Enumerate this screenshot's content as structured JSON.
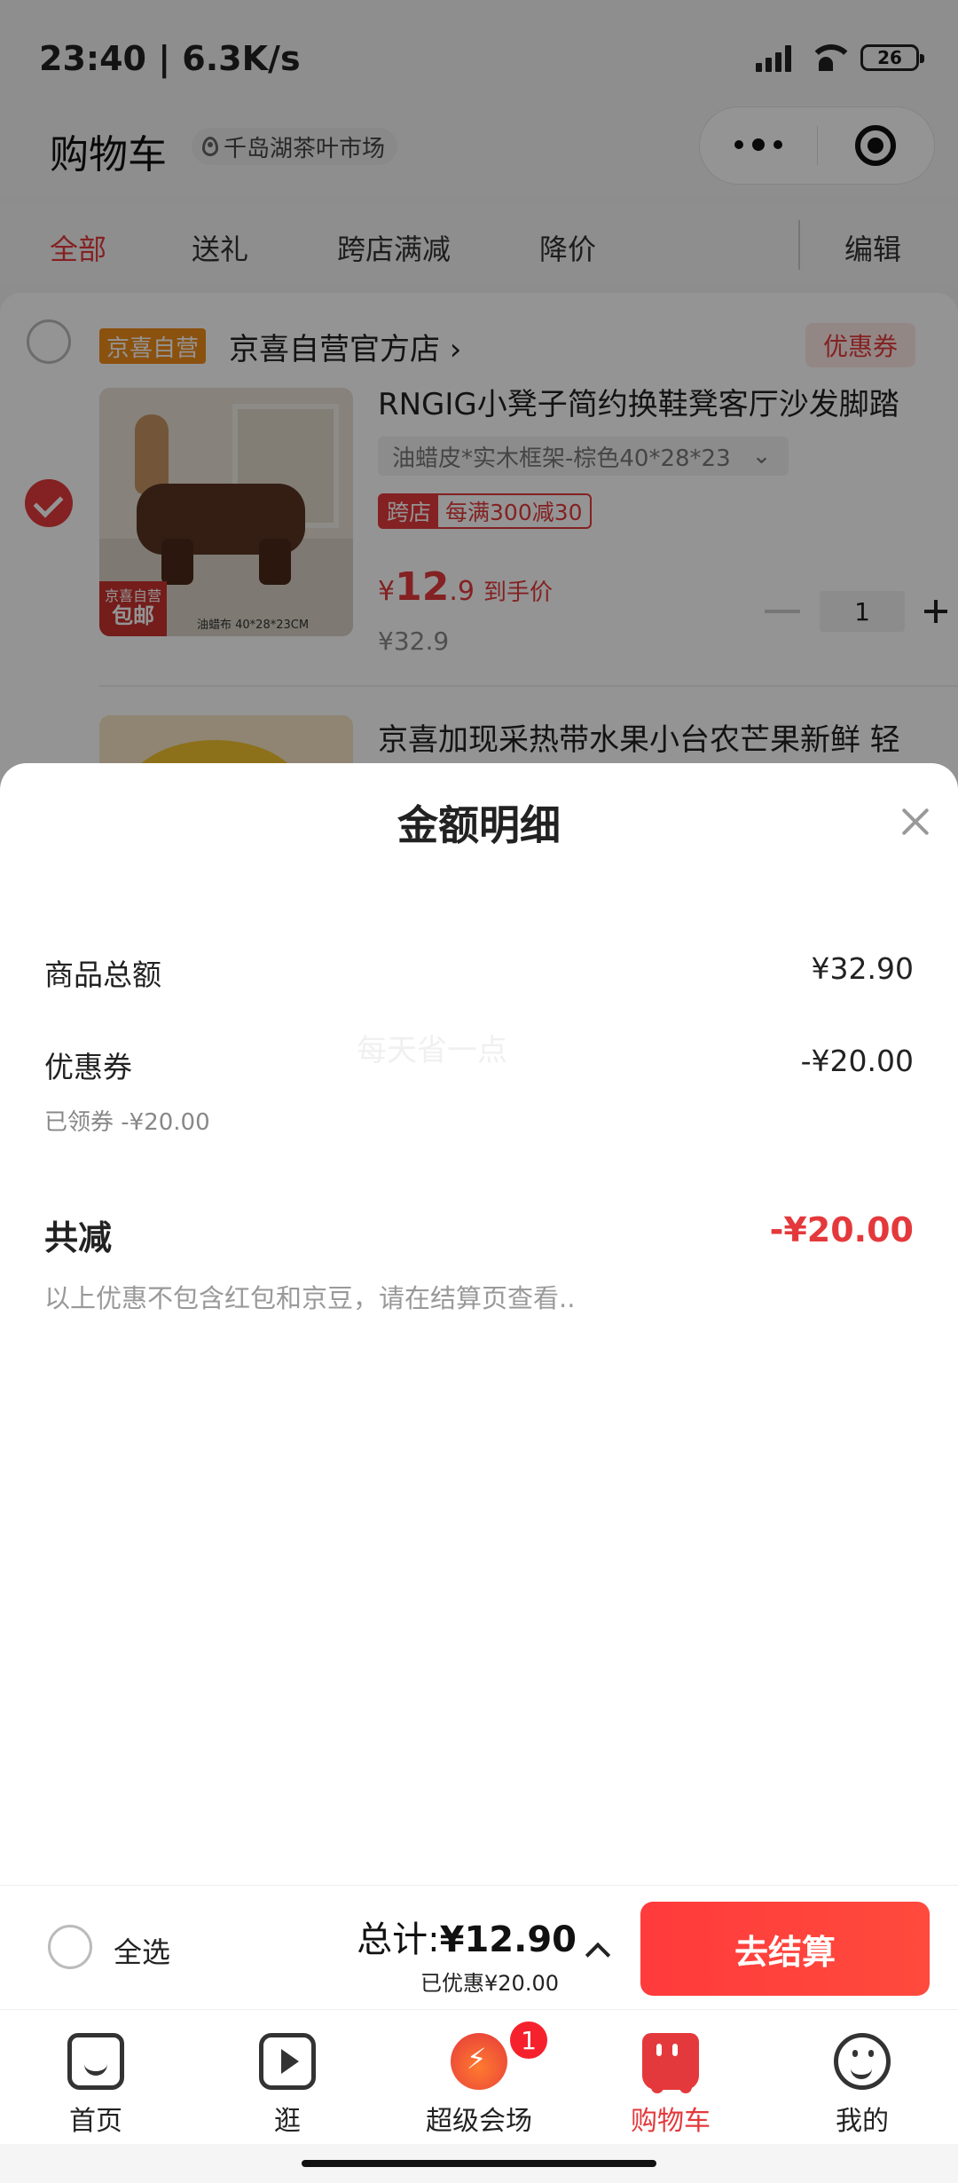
{
  "status_bar": {
    "time": "23:40 | 6.3K/s",
    "battery": "26"
  },
  "header": {
    "title": "购物车",
    "location": "千岛湖茶叶市场"
  },
  "filter_tabs": {
    "all": "全部",
    "gift": "送礼",
    "cross_store": "跨店满减",
    "price_drop": "降价",
    "edit": "编辑",
    "active": "全部"
  },
  "shop": {
    "tag": "京喜自营",
    "name": "京喜自营官方店 ›",
    "coupon_label": "优惠券"
  },
  "items": [
    {
      "title": "RNGIG小凳子简约换鞋凳客厅沙发脚踏",
      "variant": "油蜡皮*实木框架-棕色40*28*23",
      "promo_tag": "跨店",
      "promo_text": "每满300减30",
      "price_symbol": "¥",
      "price_int": "12",
      "price_dec": ".9",
      "price_label": "到手价",
      "original_price": "¥32.9",
      "quantity": "1",
      "thumb_badge_top": "京喜自营",
      "thumb_badge": "包邮",
      "thumb_spec": "油蜡布   40*28*23CM",
      "checked": true
    },
    {
      "title": "京喜加现采热带水果小台农芒果新鲜 轻"
    }
  ],
  "sheet": {
    "title": "金额明细",
    "goods_total_label": "商品总额",
    "goods_total_value": "¥32.90",
    "coupon_label": "优惠券",
    "coupon_value": "-¥20.00",
    "coupon_note": "已领券 -¥20.00",
    "watermark": "每天省一点",
    "total_discount_label": "共减",
    "total_discount_value": "-¥20.00",
    "hint": "以上优惠不包含红包和京豆，请在结算页查看.."
  },
  "checkout": {
    "select_all": "全选",
    "total_prefix": "总计:",
    "total_amount": "¥12.90",
    "saved": "已优惠¥20.00",
    "button": "去结算"
  },
  "tabbar": {
    "home": "首页",
    "browse": "逛",
    "super": "超级会场",
    "super_badge": "1",
    "cart": "购物车",
    "mine": "我的",
    "active": "购物车"
  },
  "colors": {
    "accent": "#e4393c",
    "orange_tag": "#f08c1a"
  }
}
